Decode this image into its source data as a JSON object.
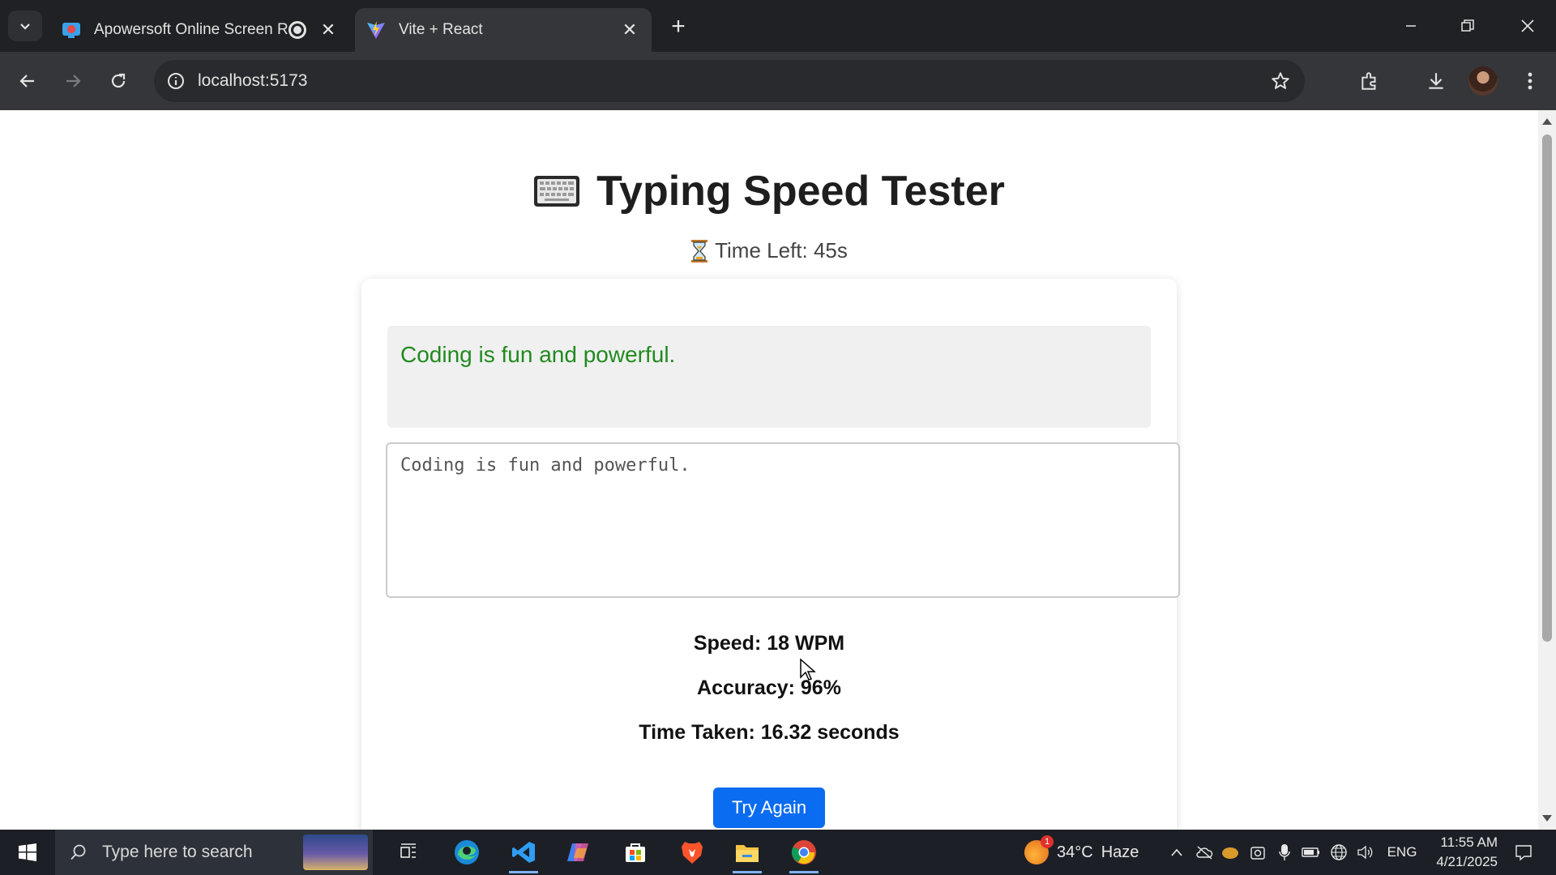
{
  "browser": {
    "tabs": [
      {
        "title": "Apowersoft Online Screen R",
        "active": false
      },
      {
        "title": "Vite + React",
        "active": true
      }
    ],
    "address": "localhost:5173"
  },
  "page": {
    "title": "Typing Speed Tester",
    "time_left_label": "Time Left: 45s",
    "sentence": "Coding is fun and powerful.",
    "typed_text": "Coding is fun and powerful.",
    "stats": {
      "speed": "Speed: 18 WPM",
      "accuracy": "Accuracy: 96%",
      "time_taken": "Time Taken: 16.32 seconds"
    },
    "try_again_label": "Try Again",
    "sentence_color": "#218a1f",
    "button_color": "#0a6cf0"
  },
  "taskbar": {
    "search_placeholder": "Type here to search",
    "weather": {
      "temp": "34°C",
      "condition": "Haze",
      "alerts": "1"
    },
    "language": "ENG",
    "time": "11:55 AM",
    "date": "4/21/2025"
  }
}
